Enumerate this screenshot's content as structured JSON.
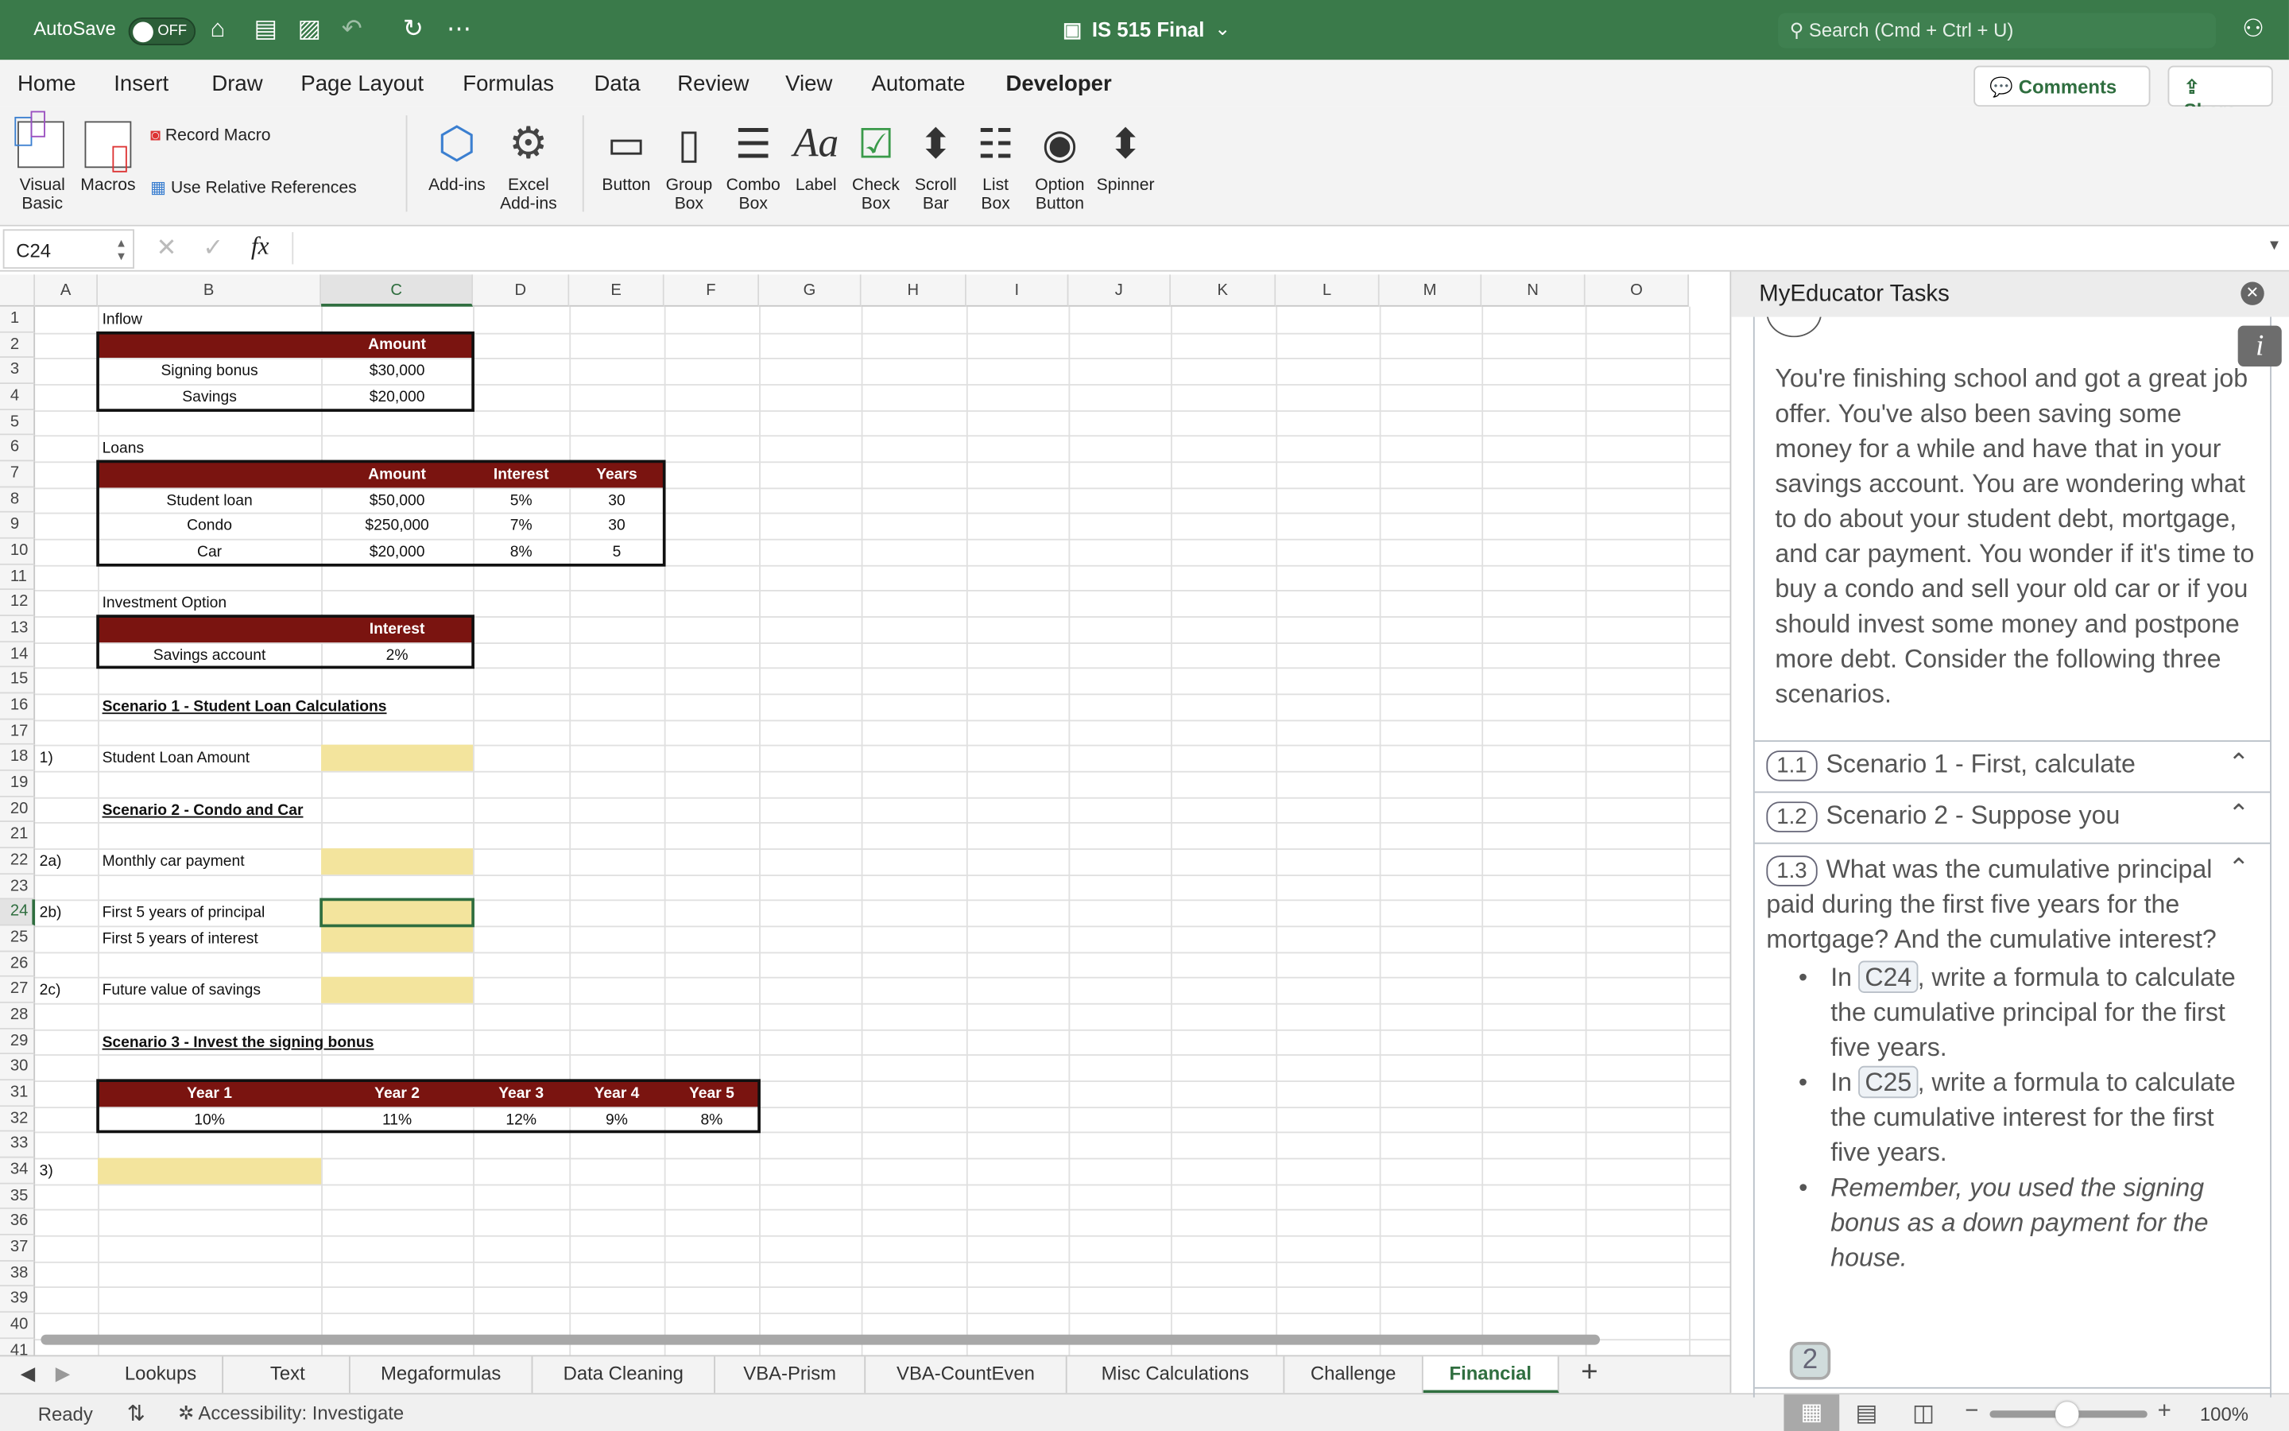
{
  "titlebar": {
    "autosave": "AutoSave",
    "autosave_state": "OFF",
    "title": "IS 515 Final",
    "search_placeholder": "Search (Cmd + Ctrl + U)"
  },
  "tabs": [
    "Home",
    "Insert",
    "Draw",
    "Page Layout",
    "Formulas",
    "Data",
    "Review",
    "View",
    "Automate",
    "Developer"
  ],
  "active_tab": "Developer",
  "top_buttons": {
    "comments": "Comments",
    "share": "Share"
  },
  "ribbon": {
    "visual_basic": [
      "Visual",
      "Basic"
    ],
    "macros": "Macros",
    "record_macro": "Record Macro",
    "use_relative": "Use Relative References",
    "addins": "Add-ins",
    "excel_addins": [
      "Excel",
      "Add-ins"
    ],
    "controls": [
      [
        "Button",
        ""
      ],
      [
        "Group",
        "Box"
      ],
      [
        "Combo",
        "Box"
      ],
      [
        "Label",
        ""
      ],
      [
        "Check",
        "Box"
      ],
      [
        "Scroll",
        "Bar"
      ],
      [
        "List",
        "Box"
      ],
      [
        "Option",
        "Button"
      ],
      [
        "Spinner",
        ""
      ]
    ]
  },
  "formula_bar": {
    "name_box": "C24",
    "fx": "fx",
    "formula": ""
  },
  "sheet": {
    "columns": [
      "A",
      "B",
      "C",
      "D",
      "E",
      "F",
      "G",
      "H",
      "I",
      "J",
      "K",
      "L",
      "M",
      "N",
      "O"
    ],
    "selected": "C24",
    "cells": {
      "B1": "Inflow",
      "C2": "Amount",
      "B3": "Signing bonus",
      "C3": "$30,000",
      "B4": "Savings",
      "C4": "$20,000",
      "B6": "Loans",
      "C7": "Amount",
      "D7": "Interest",
      "E7": "Years",
      "B8": "Student loan",
      "C8": "$50,000",
      "D8": "5%",
      "E8": "30",
      "B9": "Condo",
      "C9": "$250,000",
      "D9": "7%",
      "E9": "30",
      "B10": "Car",
      "C10": "$20,000",
      "D10": "8%",
      "E10": "5",
      "B12": "Investment Option",
      "C13": "Interest",
      "B14": "Savings account",
      "C14": "2%",
      "B16": "Scenario 1 - Student Loan Calculations",
      "A18": "1)",
      "B18": "Student Loan Amount",
      "B20": "Scenario 2 - Condo and Car",
      "A22": "2a)",
      "B22": "Monthly car payment",
      "A24": "2b)",
      "B24": "First 5 years of principal",
      "B25": "First 5 years of interest",
      "A27": "2c)",
      "B27": "Future value of savings",
      "B29": "Scenario 3 - Invest the signing bonus",
      "B31": "Year 1",
      "C31": "Year 2",
      "D31": "Year 3",
      "E31": "Year 4",
      "F31": "Year 5",
      "B32": "10%",
      "C32": "11%",
      "D32": "12%",
      "E32": "9%",
      "F32": "8%",
      "A34": "3)"
    }
  },
  "sheet_tabs": [
    "Lookups",
    "Text",
    "Megaformulas",
    "Data Cleaning",
    "VBA-Prism",
    "VBA-CountEven",
    "Misc Calculations",
    "Challenge",
    "Financial"
  ],
  "active_sheet": "Financial",
  "status": {
    "ready": "Ready",
    "accessibility": "Accessibility: Investigate",
    "zoom": "100%",
    "zoom_level": 100
  },
  "panel": {
    "title": "MyEducator Tasks",
    "intro": "You're finishing school and got a great job offer. You've also been saving some money for a while and have that in your savings account. You are wondering what to do about your student debt, mortgage, and car payment. You wonder if it's time to buy a condo and sell your old car or if you should invest some money and postpone more debt. Consider the following three scenarios.",
    "sections": [
      {
        "num": "1.1",
        "label": "Scenario 1 - First, calculate"
      },
      {
        "num": "1.2",
        "label": "Scenario 2 - Suppose you"
      },
      {
        "num": "1.3",
        "label": "What was the cumulative principal paid during the first five years for the mortgage? And the cumulative interest?"
      }
    ],
    "bullets": [
      {
        "pre": "In ",
        "ref": "C24",
        "post": ", write a formula to calculate the cumulative principal for the first five years."
      },
      {
        "pre": "In ",
        "ref": "C25",
        "post": ", write a formula to calculate the cumulative interest for the first five years."
      }
    ],
    "note": "Remember, you used the signing bonus as a down payment for the house.",
    "next_step": "2"
  },
  "colors": {
    "title_green": "#3a7a4a",
    "header_maroon": "#7a1410",
    "input_yellow": "#f3e49d",
    "accent_green": "#2f6e3f"
  }
}
